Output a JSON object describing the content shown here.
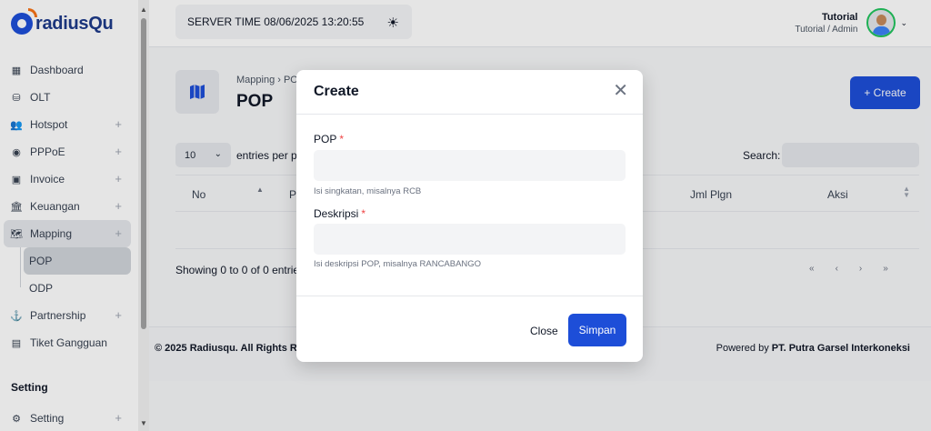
{
  "brand": {
    "name": "radiusQu"
  },
  "sidebar": {
    "items": [
      {
        "label": "Dashboard",
        "icon": "dashboard-icon",
        "expandable": false
      },
      {
        "label": "OLT",
        "icon": "server-icon",
        "expandable": false
      },
      {
        "label": "Hotspot",
        "icon": "users-icon",
        "expandable": true
      },
      {
        "label": "PPPoE",
        "icon": "globe-icon",
        "expandable": true
      },
      {
        "label": "Invoice",
        "icon": "invoice-icon",
        "expandable": true
      },
      {
        "label": "Keuangan",
        "icon": "bank-icon",
        "expandable": true
      },
      {
        "label": "Mapping",
        "icon": "map-icon",
        "expandable": true,
        "active": true
      }
    ],
    "mapping_children": [
      {
        "label": "POP",
        "active": true
      },
      {
        "label": "ODP",
        "active": false
      }
    ],
    "items_after": [
      {
        "label": "Partnership",
        "icon": "partnership-icon",
        "expandable": true
      },
      {
        "label": "Tiket Gangguan",
        "icon": "ticket-icon",
        "expandable": false
      }
    ],
    "section_setting": "Setting",
    "setting_item": {
      "label": "Setting",
      "icon": "gear-icon",
      "expandable": true
    }
  },
  "topbar": {
    "server_time": "SERVER TIME 08/06/2025 13:20:55",
    "theme_icon": "sun-icon",
    "user_name": "Tutorial",
    "user_role": "Tutorial / Admin"
  },
  "page": {
    "breadcrumb": "Mapping › PO",
    "title": "POP",
    "create_label": "+ Create",
    "entries_value": "10",
    "entries_label": "entries per pa",
    "search_label": "Search:",
    "columns": [
      "No",
      "P",
      "Jml Plgn",
      "Aksi"
    ],
    "showing": "Showing 0 to 0 of 0 entries",
    "pager": [
      "«",
      "‹",
      "›",
      "»"
    ]
  },
  "footer": {
    "left": "© 2025 Radiusqu. All Rights Re",
    "right_prefix": "Powered by ",
    "right_bold": "PT. Putra Garsel Interkoneksi"
  },
  "modal": {
    "title": "Create",
    "fields": [
      {
        "label": "POP",
        "required": "*",
        "value": "",
        "hint": "Isi singkatan, misalnya RCB"
      },
      {
        "label": "Deskripsi",
        "required": "*",
        "value": "",
        "hint": "Isi deskripsi POP, misalnya RANCABANGO"
      }
    ],
    "close_label": "Close",
    "save_label": "Simpan"
  },
  "colors": {
    "primary": "#1d4ed8",
    "required": "#ef4444",
    "accent_orange": "#f97316"
  }
}
